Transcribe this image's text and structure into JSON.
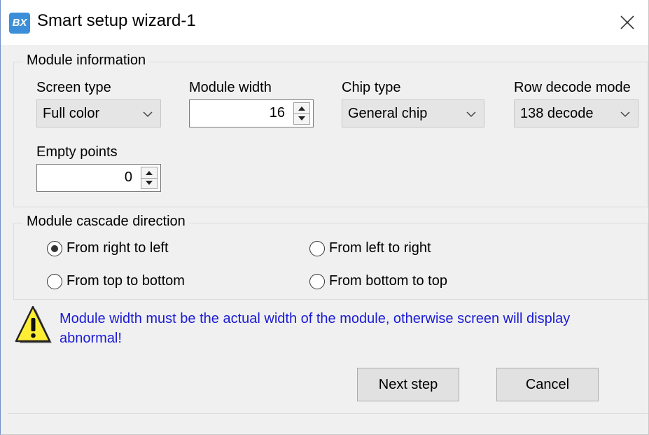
{
  "window": {
    "title": "Smart setup wizard-1",
    "icon_text": "BX",
    "close_icon": "close-icon"
  },
  "module_information": {
    "group_title": "Module information",
    "screen_type": {
      "label": "Screen type",
      "value": "Full color"
    },
    "module_width": {
      "label": "Module width",
      "value": "16"
    },
    "chip_type": {
      "label": "Chip type",
      "value": "General chip"
    },
    "row_decode_mode": {
      "label": "Row decode mode",
      "value": "138 decode"
    },
    "empty_points": {
      "label": "Empty points",
      "value": "0"
    }
  },
  "cascade_direction": {
    "group_title": "Module cascade direction",
    "options": [
      {
        "label": "From right to left",
        "selected": true
      },
      {
        "label": "From left to right",
        "selected": false
      },
      {
        "label": "From top to bottom",
        "selected": false
      },
      {
        "label": "From bottom to top",
        "selected": false
      }
    ]
  },
  "warning": {
    "icon": "warning-icon",
    "message": "Module width must be the actual width of the module, otherwise screen will display abnormal!",
    "color": "#1a1ad6"
  },
  "buttons": {
    "next": "Next step",
    "cancel": "Cancel"
  }
}
